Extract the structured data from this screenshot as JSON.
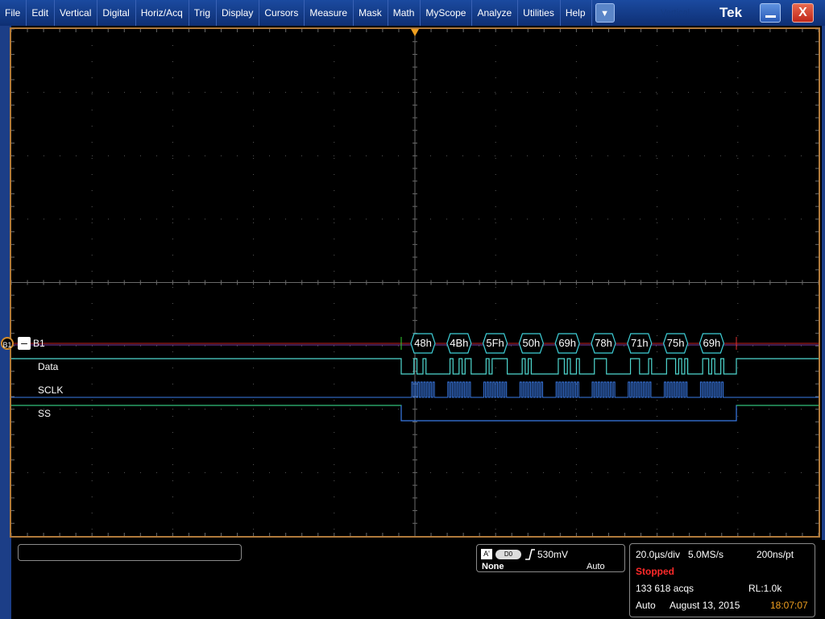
{
  "menu": {
    "items": [
      "File",
      "Edit",
      "Vertical",
      "Digital",
      "Horiz/Acq",
      "Trig",
      "Display",
      "Cursors",
      "Measure",
      "Mask",
      "Math",
      "MyScope",
      "Analyze",
      "Utilities",
      "Help"
    ],
    "dropdown_icon": "chevron-down-icon",
    "ghost_label": "Vertical"
  },
  "window": {
    "brand": "Tek",
    "close_label": "X",
    "minimize_icon": "minimize-icon"
  },
  "channels": {
    "b1_marker": "B1",
    "bus_label": "B1",
    "bus_collapse": "–",
    "data_label": "Data",
    "sclk_label": "SCLK",
    "ss_label": "SS"
  },
  "bus": {
    "decoded_bytes": [
      "48h",
      "4Bh",
      "5Fh",
      "50h",
      "69h",
      "78h",
      "71h",
      "75h",
      "69h"
    ]
  },
  "trigger": {
    "source_badge": "A'",
    "channel_badge": "D0",
    "level": "530mV",
    "type": "None",
    "mode": "Auto"
  },
  "horizontal": {
    "scale": "20.0µs/div",
    "sample_rate": "5.0MS/s",
    "resolution": "200ns/pt",
    "state": "Stopped",
    "acquisitions": "133 618 acqs",
    "record_length": "RL:1.0k",
    "mode": "Auto",
    "date": "August 13, 2015",
    "time": "18:07:07"
  },
  "colors": {
    "bus": "#3fd0d8",
    "data": "#4fd8d0",
    "sclk": "#3a7be8",
    "ss": "#3a7be8",
    "trigger_marker": "#f0a020",
    "stopped": "#ff2a2a",
    "time": "#f0a020"
  }
}
